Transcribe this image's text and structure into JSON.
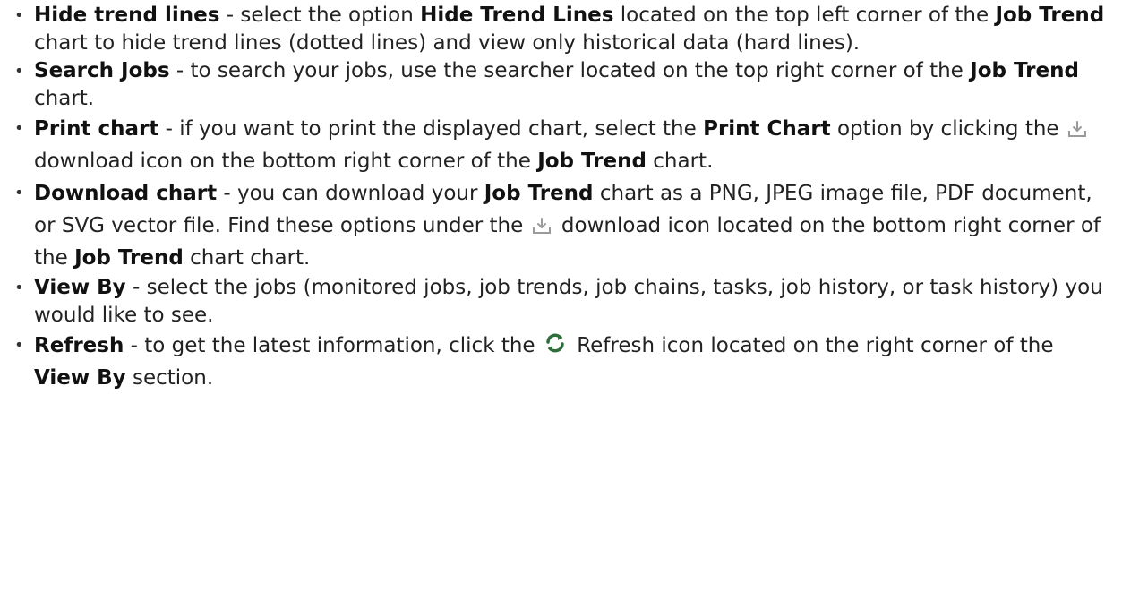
{
  "items": [
    {
      "term": "Hide trend lines",
      "t1": " - select the option ",
      "b1": "Hide Trend Lines",
      "t2": " located on the top left corner of the ",
      "b2": "Job Trend",
      "t3": " chart to hide trend lines (dotted lines) and view only historical data (hard lines)."
    },
    {
      "term": "Search Jobs",
      "t1": " - to search your jobs, use the searcher located on the top right corner of the ",
      "b1": "Job Trend",
      "t2": " chart."
    },
    {
      "term": "Print chart",
      "t1": " - if you want to print the displayed chart, select the ",
      "b1": "Print Chart",
      "t2": " option by clicking the ",
      "icon": "download-icon",
      "t3": " download icon on the bottom right corner of the ",
      "b2": "Job Trend",
      "t4": " chart."
    },
    {
      "term": "Download chart",
      "t1": " - you can download your ",
      "b1": "Job Trend",
      "t2": " chart as a PNG, JPEG image file, PDF document, or SVG vector file. Find these options under the ",
      "icon": "download-icon",
      "t3": " download icon located on the bottom right corner of the ",
      "b2": "Job Trend",
      "t4": " chart chart."
    },
    {
      "term": "View By",
      "t1": " - select the jobs (monitored jobs, job trends, job chains, tasks, job history, or task history) you would like to see."
    },
    {
      "term": "Refresh",
      "t1": " - to get the latest information, click the ",
      "icon": "refresh-icon",
      "t2": " Refresh icon located on the right corner of the ",
      "b1": "View By",
      "t3": " section."
    }
  ],
  "colors": {
    "text": "#222222",
    "icon_gray": "#9a9a9a",
    "refresh_icon": "#2d6e3b"
  }
}
